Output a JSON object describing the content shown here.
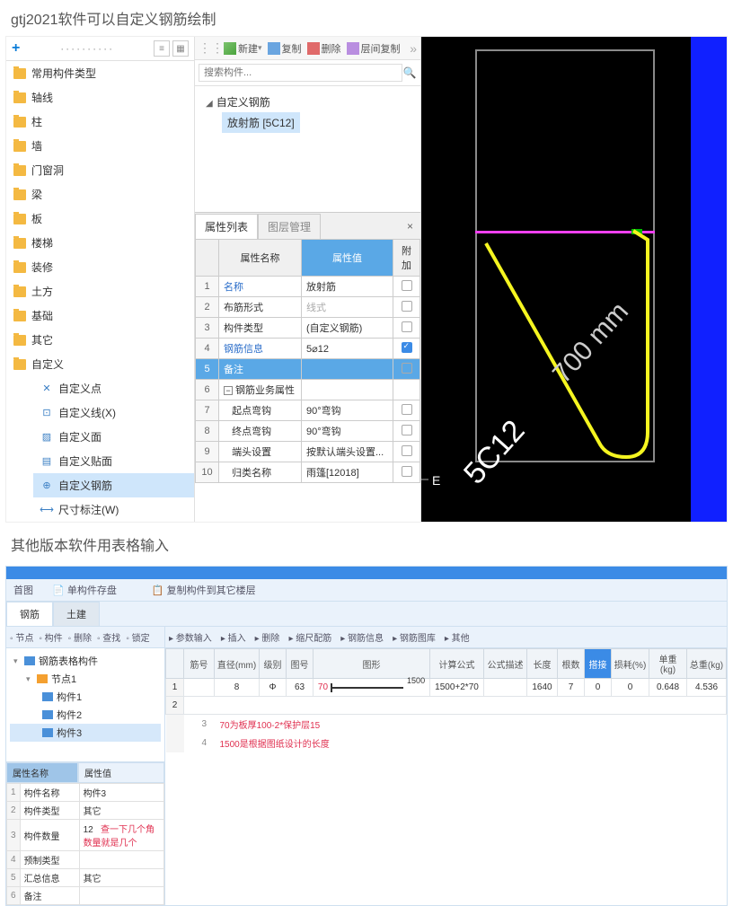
{
  "doc_title": "gtj2021软件可以自定义钢筋绘制",
  "tree_top": {
    "plus": "+",
    "list_icon": "≡",
    "card_icon": "▦"
  },
  "treeItems": [
    "常用构件类型",
    "轴线",
    "柱",
    "墙",
    "门窗洞",
    "梁",
    "板",
    "楼梯",
    "装修",
    "土方",
    "基础",
    "其它",
    "自定义"
  ],
  "customSubs": [
    {
      "icon": "✕",
      "label": "自定义点"
    },
    {
      "icon": "⊡",
      "label": "自定义线(X)"
    },
    {
      "icon": "▨",
      "label": "自定义面"
    },
    {
      "icon": "▤",
      "label": "自定义贴面"
    },
    {
      "icon": "⊕",
      "label": "自定义钢筋",
      "sel": true
    },
    {
      "icon": "⟷",
      "label": "尺寸标注(W)"
    }
  ],
  "midToolbar": {
    "new": "新建",
    "copy": "复制",
    "delete": "删除",
    "layerCopy": "层间复制"
  },
  "search_placeholder": "搜索构件...",
  "compTree": {
    "parent": "自定义钢筋",
    "child": "放射筋  [5C12]"
  },
  "propTabs": {
    "tab1": "属性列表",
    "tab2": "图层管理"
  },
  "propHead": {
    "name": "属性名称",
    "value": "属性值",
    "extra": "附加"
  },
  "propRows": [
    {
      "n": "1",
      "name": "名称",
      "val": "放射筋",
      "link": true
    },
    {
      "n": "2",
      "name": "布筋形式",
      "val": "线式",
      "gray": true
    },
    {
      "n": "3",
      "name": "构件类型",
      "val": "(自定义钢筋)"
    },
    {
      "n": "4",
      "name": "钢筋信息",
      "val": "5⌀12",
      "link": true,
      "chk": true
    },
    {
      "n": "5",
      "name": "备注",
      "val": "",
      "sel": true
    },
    {
      "n": "6",
      "name": "钢筋业务属性",
      "val": "",
      "expand": true
    },
    {
      "n": "7",
      "name": "起点弯钩",
      "val": "90°弯钩",
      "indent": true
    },
    {
      "n": "8",
      "name": "终点弯钩",
      "val": "90°弯钩",
      "indent": true
    },
    {
      "n": "9",
      "name": "端头设置",
      "val": "按默认端头设置...",
      "indent": true
    },
    {
      "n": "10",
      "name": "归类名称",
      "val": "雨篷[12018]",
      "indent": true
    }
  ],
  "viewport": {
    "label1": "5C12",
    "label2": "700 mm",
    "marker": "E"
  },
  "sec2_title": "其他版本软件用表格输入",
  "s2menu": {
    "home": "首图",
    "save": "单构件存盘",
    "copy": "复制构件到其它楼层"
  },
  "s2tabs": {
    "steel": "钢筋",
    "civil": "土建"
  },
  "s2left_tb": [
    "节点",
    "构件",
    "删除",
    "查找",
    "锁定"
  ],
  "s2tree": {
    "root": "钢筋表格构件",
    "n1": "节点1",
    "c1": "构件1",
    "c2": "构件2",
    "c3": "构件3"
  },
  "s2prop_head": {
    "name": "属性名称",
    "val": "属性值"
  },
  "s2prop": [
    {
      "n": "1",
      "name": "构件名称",
      "val": "构件3"
    },
    {
      "n": "2",
      "name": "构件类型",
      "val": "其它"
    },
    {
      "n": "3",
      "name": "构件数量",
      "val": "12"
    },
    {
      "n": "4",
      "name": "预制类型",
      "val": ""
    },
    {
      "n": "5",
      "name": "汇总信息",
      "val": "其它"
    },
    {
      "n": "6",
      "name": "备注",
      "val": ""
    }
  ],
  "s2prop_annot": "查一下几个角数量就是几个",
  "s2right_tb": [
    "参数输入",
    "插入",
    "删除",
    "缩尺配筋",
    "钢筋信息",
    "钢筋图库",
    "其他"
  ],
  "dtHead": [
    "筋号",
    "直径(mm)",
    "级别",
    "图号",
    "图形",
    "计算公式",
    "公式描述",
    "长度",
    "根数",
    "搭接",
    "损耗(%)",
    "单重(kg)",
    "总重(kg)"
  ],
  "hl_col": 9,
  "dtRow": {
    "rn": "1",
    "bar": "",
    "dia": "8",
    "grade": "Φ",
    "fig": "63",
    "shape_l": "70",
    "shape_len": "1500",
    "formula": "1500+2*70",
    "desc": "",
    "len": "1640",
    "count": "7",
    "lap": "0",
    "loss": "0",
    "uw": "0.648",
    "tw": "4.536"
  },
  "annot1": "70为板厚100-2*保护层15",
  "annot2": "1500是根据图纸设计的长度"
}
